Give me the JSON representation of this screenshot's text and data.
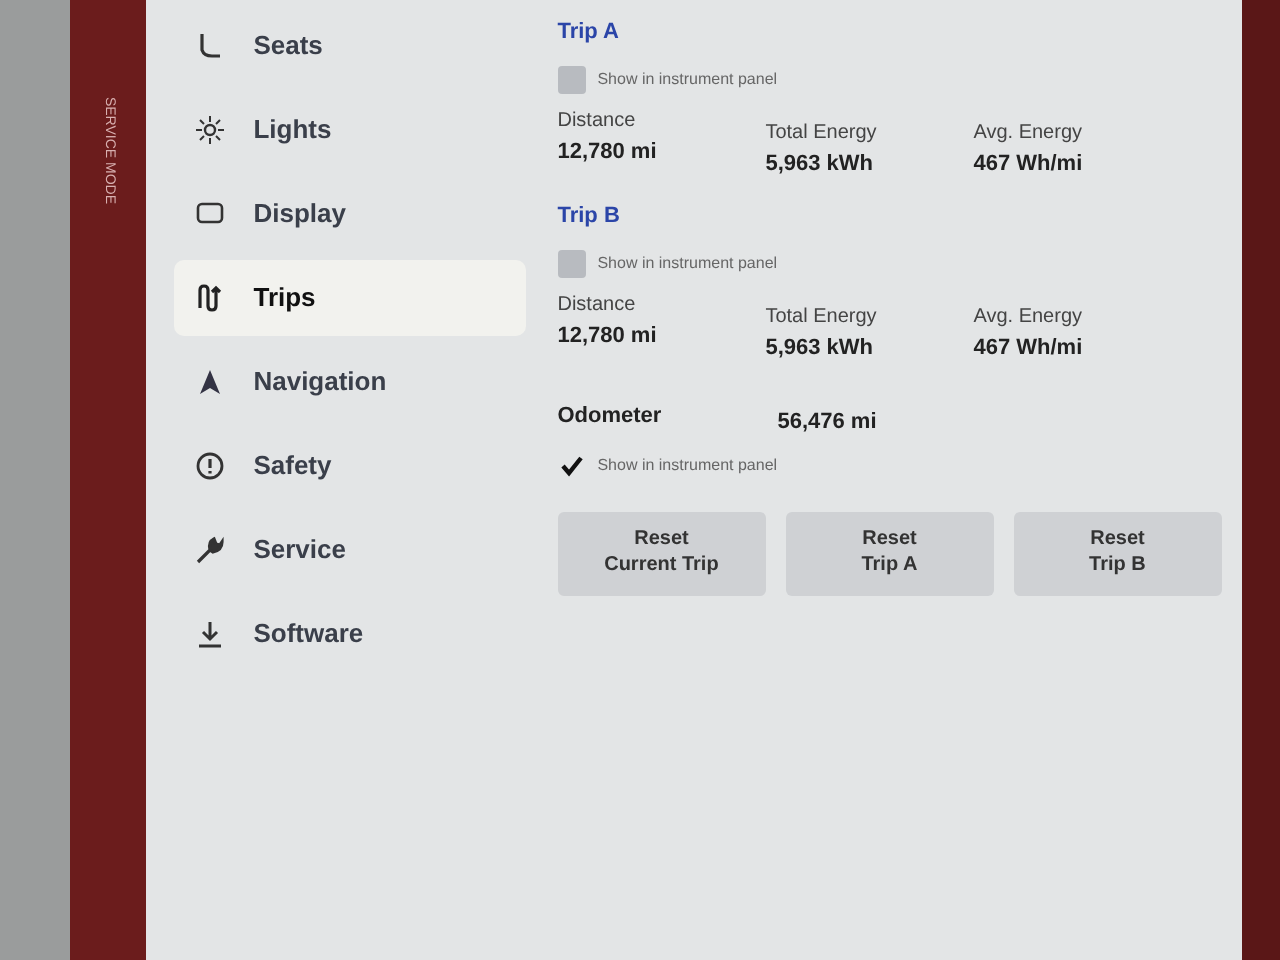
{
  "frame_label": "SERVICE MODE",
  "sidebar": {
    "items": [
      {
        "label": "Seats",
        "selected": false
      },
      {
        "label": "Lights",
        "selected": false
      },
      {
        "label": "Display",
        "selected": false
      },
      {
        "label": "Trips",
        "selected": true
      },
      {
        "label": "Navigation",
        "selected": false
      },
      {
        "label": "Safety",
        "selected": false
      },
      {
        "label": "Service",
        "selected": false
      },
      {
        "label": "Software",
        "selected": false
      }
    ]
  },
  "trips": [
    {
      "title": "Trip A",
      "show_label": "Show in instrument panel",
      "checked": false,
      "stats": [
        {
          "label": "Distance",
          "value": "12,780 mi"
        },
        {
          "label": "Total Energy",
          "value": "5,963 kWh"
        },
        {
          "label": "Avg. Energy",
          "value": "467 Wh/mi"
        }
      ]
    },
    {
      "title": "Trip B",
      "show_label": "Show in instrument panel",
      "checked": false,
      "stats": [
        {
          "label": "Distance",
          "value": "12,780 mi"
        },
        {
          "label": "Total Energy",
          "value": "5,963 kWh"
        },
        {
          "label": "Avg. Energy",
          "value": "467 Wh/mi"
        }
      ]
    }
  ],
  "odometer": {
    "label": "Odometer",
    "value": "56,476 mi",
    "show_label": "Show in instrument panel",
    "checked": true
  },
  "buttons": [
    "Reset\nCurrent Trip",
    "Reset\nTrip A",
    "Reset\nTrip B"
  ]
}
